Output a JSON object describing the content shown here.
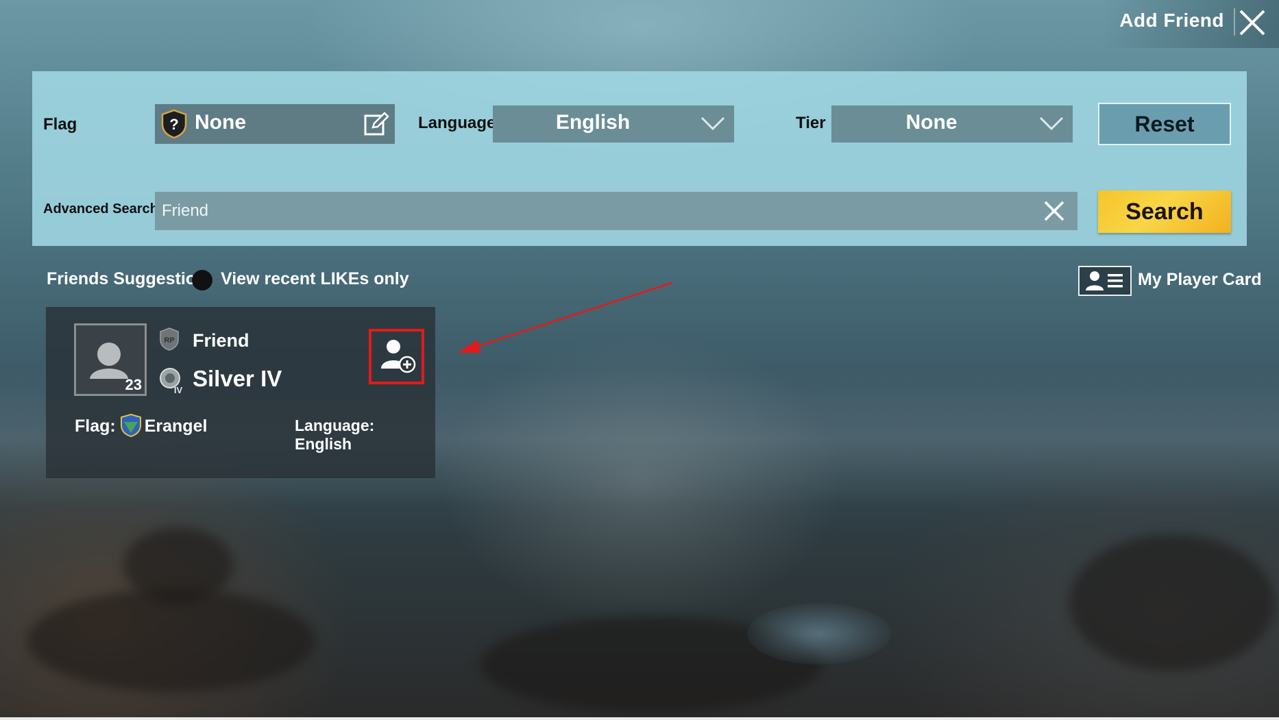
{
  "header": {
    "title": "Add Friend",
    "close_icon": "close-icon"
  },
  "filters": {
    "flag": {
      "label": "Flag",
      "value": "None",
      "icon": "flag-shield-icon"
    },
    "language": {
      "label": "Language",
      "value": "English"
    },
    "tier": {
      "label": "Tier",
      "value": "None"
    },
    "reset_label": "Reset",
    "advanced_search": {
      "label": "Advanced Search",
      "value": "Friend"
    },
    "search_label": "Search"
  },
  "suggestions": {
    "title": "Friends Suggestion",
    "toggle_label": "View recent LIKEs only",
    "player_card_label": "My Player Card"
  },
  "friend_card": {
    "level": "23",
    "name": "Friend",
    "tier": "Silver IV",
    "flag_prefix": "Flag:",
    "flag_value": "Erangel",
    "language": "Language: English"
  },
  "colors": {
    "panel": "#a0d7e4",
    "search_button": "#f6c42b",
    "highlight": "#e11b1b"
  }
}
